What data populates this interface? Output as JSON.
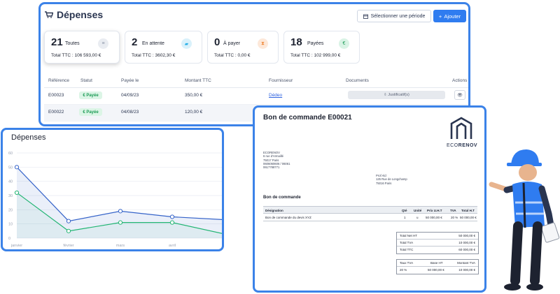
{
  "expenses": {
    "title": "Dépenses",
    "period_button": "Sélectionner une période",
    "add_button": "Ajouter",
    "cards": [
      {
        "count": "21",
        "label": "Toutes",
        "total": "Total TTC : 106 593,00 €",
        "icon": "list-icon",
        "color": "#8b93a6"
      },
      {
        "count": "2",
        "label": "En attente",
        "total": "Total TTC : 3602,30 €",
        "icon": "truck-icon",
        "color": "#2ab0e8"
      },
      {
        "count": "0",
        "label": "À payer",
        "total": "Total TTC : 0,00 €",
        "icon": "hourglass-icon",
        "color": "#f08a3c"
      },
      {
        "count": "18",
        "label": "Payées",
        "total": "Total TTC : 102 999,00 €",
        "icon": "euro-icon",
        "color": "#1c9b55"
      }
    ],
    "columns": [
      "Référence",
      "Statut",
      "Payée le",
      "Montant TTC",
      "Fournisseur",
      "Documents",
      "Actions"
    ],
    "rows": [
      {
        "ref": "E00023",
        "status": "€ Payée",
        "date": "04/09/23",
        "amount": "350,00 €",
        "supplier": "Dédeo",
        "document": "⇩ Justificatif(s)",
        "action": "👁"
      },
      {
        "ref": "E00022",
        "status": "€ Payée",
        "date": "04/08/23",
        "amount": "120,00 €",
        "supplier": "",
        "document": "",
        "action": ""
      }
    ]
  },
  "chart": {
    "title": "Dépenses"
  },
  "chart_data": {
    "type": "line",
    "title": "Dépenses",
    "categories": [
      "janvier",
      "février",
      "mars",
      "avril",
      ""
    ],
    "ylim": [
      0,
      60
    ],
    "yticks": [
      "0",
      "10",
      "20",
      "30",
      "40",
      "50",
      "60"
    ],
    "grid": true,
    "series": [
      {
        "color": "#3563c9",
        "values": [
          50,
          12,
          19,
          15,
          13
        ]
      },
      {
        "color": "#22b573",
        "values": [
          32,
          5,
          11,
          11,
          3
        ]
      }
    ]
  },
  "invoice": {
    "title": "Bon de commande E00021",
    "logo_text_a": "ECO",
    "logo_text_b": "RENOV",
    "company_lines": [
      "ECORENOV",
      "6 rue d'Armaillé",
      "75017 Paris",
      "0606060606 / 06061",
      "0617788771"
    ],
    "client_lines": [
      "Prof Ald",
      "125 Rue de Longchamp",
      "75016 Paris"
    ],
    "section": "Bon de commande",
    "table_headers": [
      "Désignation",
      "Qté",
      "Unité",
      "Prix U.H.T",
      "TVA",
      "Total H.T"
    ],
    "table_row": [
      "Bon de commande du devis XYZ",
      "1",
      "u",
      "50 000,00 €",
      "20 %",
      "50 000,00 €"
    ],
    "totals": [
      [
        "Total Net HT",
        "50 000,00 €"
      ],
      [
        "Total TVA",
        "10 000,00 €"
      ],
      [
        "Total TTC",
        "60 000,00 €"
      ]
    ],
    "vat_headers": [
      "Taux TVA",
      "Base HT",
      "Montant TVA"
    ],
    "vat_row": [
      "20 %",
      "50 000,00 €",
      "10 000,00 €"
    ]
  }
}
